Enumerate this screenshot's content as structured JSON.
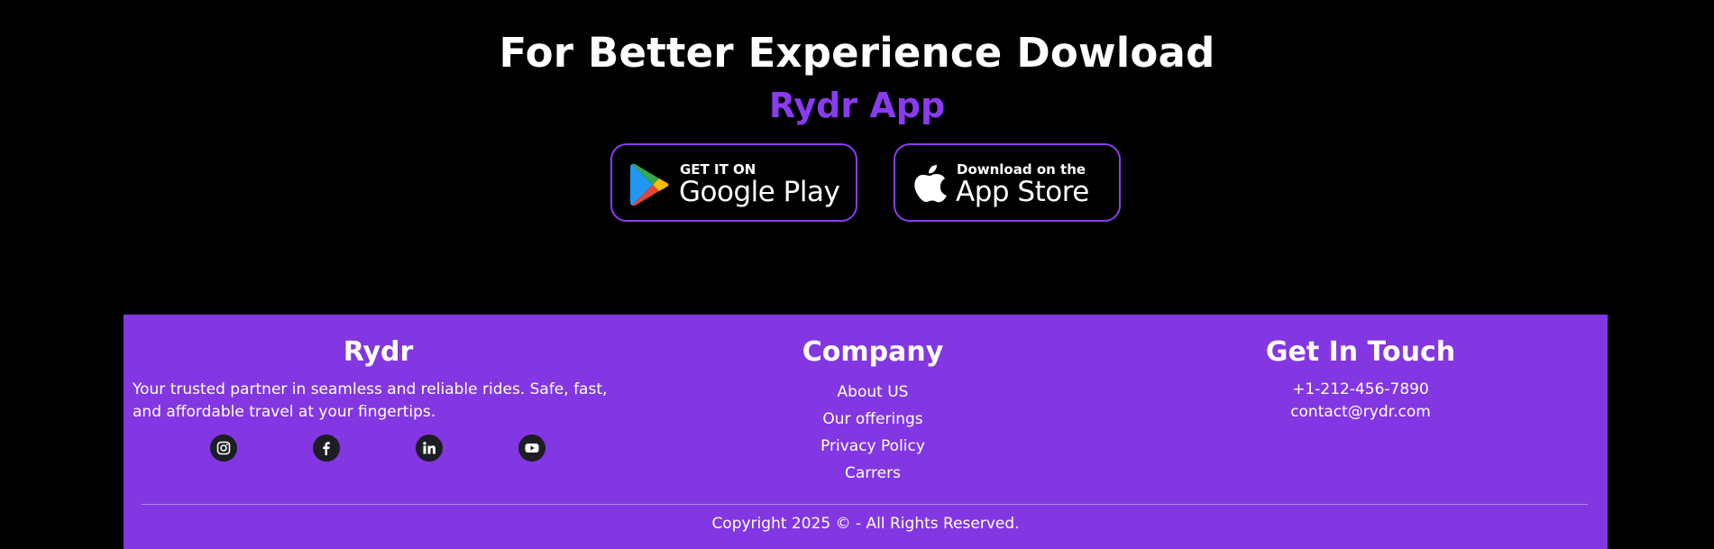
{
  "hero": {
    "title": "For Better Experience Dowload",
    "subtitle": "Rydr App",
    "accent_color": "#8a3bf2"
  },
  "stores": [
    {
      "small": "GET IT ON",
      "big": "Google Play",
      "icon": "google-play-icon"
    },
    {
      "small": "Download on the",
      "big": "App Store",
      "icon": "apple-icon"
    }
  ],
  "footer": {
    "background": "#8237e2",
    "brand": {
      "title": "Rydr",
      "description": "Your trusted partner in seamless and reliable rides. Safe, fast, and affordable travel at your fingertips.",
      "socials": [
        "instagram-icon",
        "facebook-icon",
        "linkedin-icon",
        "youtube-icon"
      ]
    },
    "company": {
      "title": "Company",
      "links": [
        "About US",
        "Our offerings",
        "Privacy Policy",
        "Carrers"
      ]
    },
    "contact": {
      "title": "Get In Touch",
      "phone": "+1-212-456-7890",
      "email": "contact@rydr.com"
    },
    "copyright": "Copyright 2025 © - All Rights Reserved."
  }
}
